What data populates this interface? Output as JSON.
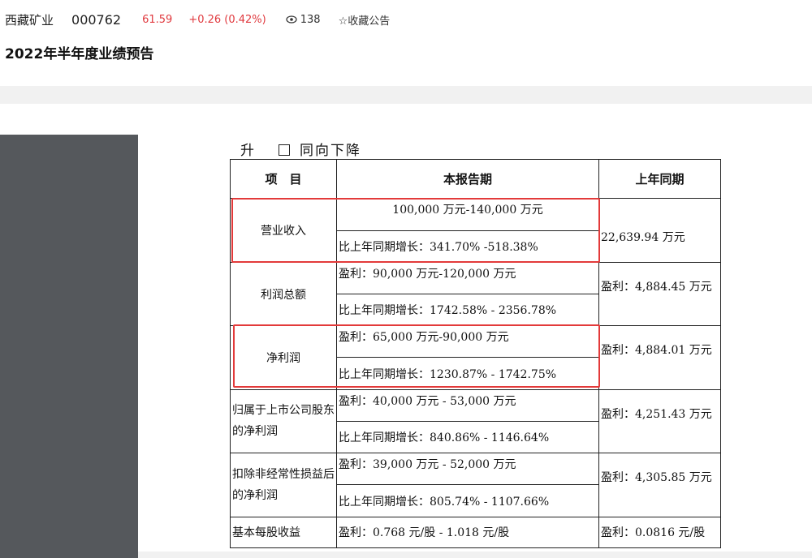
{
  "stock": {
    "name": "西藏矿业",
    "code": "000762",
    "price": "61.59",
    "change": "+0.26 (0.42%)",
    "views": "138",
    "fav_label": "☆收藏公告"
  },
  "page": {
    "title": "2022年半年度业绩预告"
  },
  "doc": {
    "trend": {
      "left": "升",
      "right": "同向下降"
    },
    "table": {
      "headers": [
        "项　目",
        "本报告期",
        "上年同期"
      ],
      "rows": [
        {
          "item": "营业收入",
          "current": "100,000 万元-140,000 万元",
          "growth": "比上年同期增长：341.70% -518.38%",
          "previous": "22,639.94 万元"
        },
        {
          "item": "利润总额",
          "current": "盈利：90,000 万元-120,000 万元",
          "growth": "比上年同期增长：1742.58% - 2356.78%",
          "previous": "盈利：4,884.45 万元"
        },
        {
          "item": "净利润",
          "current": "盈利：65,000 万元-90,000 万元",
          "growth": "比上年同期增长：1230.87% - 1742.75%",
          "previous": "盈利：4,884.01 万元"
        },
        {
          "item": "归属于上市公司股东的净利润",
          "current": "盈利：40,000 万元 - 53,000 万元",
          "growth": "比上年同期增长：840.86% - 1146.64%",
          "previous": "盈利：4,251.43 万元"
        },
        {
          "item": "扣除非经常性损益后的净利润",
          "current": "盈利：39,000 万元 - 52,000 万元",
          "growth": "比上年同期增长：805.74% - 1107.66%",
          "previous": "盈利：4,305.85 万元"
        },
        {
          "item": "基本每股收益",
          "current": "盈利：0.768 元/股 - 1.018 元/股",
          "previous": "盈利：0.0816 元/股"
        }
      ]
    }
  },
  "colors": {
    "up": "#e0393e",
    "highlight": "#e33a3a",
    "panel": "#55585c"
  }
}
